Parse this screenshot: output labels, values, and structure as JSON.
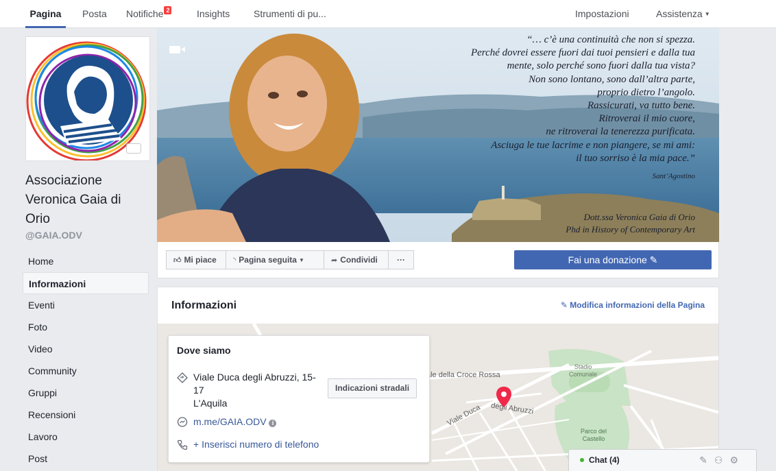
{
  "topnav": {
    "tabs": [
      {
        "label": "Pagina"
      },
      {
        "label": "Posta"
      },
      {
        "label": "Notifiche",
        "badge": "2"
      },
      {
        "label": "Insights"
      },
      {
        "label": "Strumenti di pu..."
      }
    ],
    "settings": "Impostazioni",
    "help": "Assistenza"
  },
  "page": {
    "name": "Associazione Veronica Gaia di Orio",
    "handle": "@GAIA.ODV"
  },
  "leftnav": {
    "items": [
      "Home",
      "Informazioni",
      "Eventi",
      "Foto",
      "Video",
      "Community",
      "Gruppi",
      "Recensioni",
      "Lavoro",
      "Post"
    ]
  },
  "cover": {
    "quote_lines": [
      "“… c’è una continuità che non si spezza.",
      "Perché dovrei essere fuori dai tuoi pensieri e dalla tua",
      "mente, solo perché sono fuori dalla tua vista?",
      "Non sono lontano, sono dall’altra parte,",
      "proprio dietro l’angolo.",
      "Rassicurati, va tutto bene.",
      "Ritroverai il mio cuore,",
      "ne ritroverai la tenerezza purificata.",
      "Asciuga le tue lacrime e non piangere, se mi ami:",
      "il tuo sorriso è la mia pace.”"
    ],
    "author": "Sant’Agostino",
    "signature_lines": [
      "Dott.ssa Veronica Gaia di Orio",
      "Phd in History of Contemporary Art"
    ]
  },
  "actions": {
    "like": "Mi piace",
    "following": "Pagina seguita",
    "share": "Condividi",
    "more": "···",
    "donate": "Fai una donazione"
  },
  "info": {
    "title": "Informazioni",
    "edit": "Modifica informazioni della Pagina",
    "where": {
      "title": "Dove siamo",
      "address_line1": "Viale Duca degli Abruzzi, 15-17",
      "address_line2": "L'Aquila",
      "directions": "Indicazioni stradali",
      "messenger": "m.me/GAIA.ODV",
      "phone": "+ Inserisci numero di telefono"
    },
    "map_labels": {
      "street1": "ale della Croce Rossa",
      "street2": "Viale Duca",
      "street3": "degli Abruzzi",
      "stadium": "Stadio\nComunale",
      "park": "Parco del\nCastello"
    }
  },
  "chat": {
    "label": "Chat (4)"
  },
  "colors": {
    "brand": "#4267b2",
    "link": "#385898",
    "badge": "#fa3e3e",
    "online": "#42b72a"
  }
}
